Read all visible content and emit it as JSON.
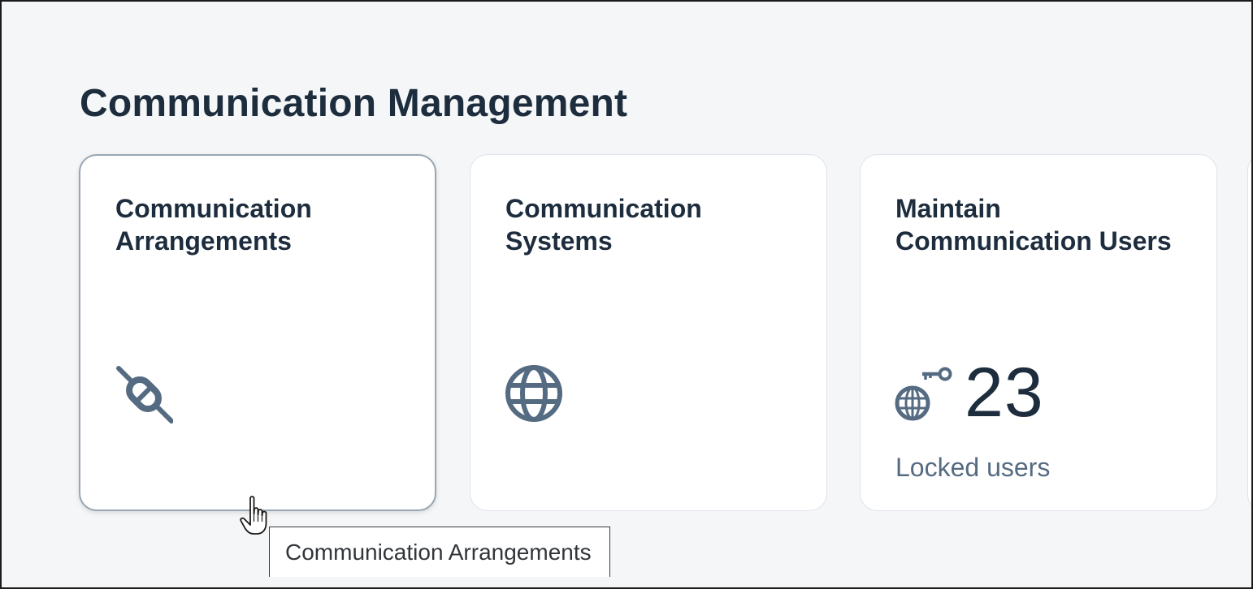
{
  "section": {
    "title": "Communication Management"
  },
  "tiles": [
    {
      "title": "Communication Arrangements",
      "icon": "plug-icon"
    },
    {
      "title": "Communication Systems",
      "icon": "globe-icon"
    },
    {
      "title": "Maintain Communication Users",
      "icon": "globe-key-icon",
      "kpi_value": "23",
      "kpi_label": "Locked users"
    }
  ],
  "tooltip": {
    "text": "Communication Arrangements"
  },
  "colors": {
    "background": "#f5f6f7",
    "tile": "#ffffff",
    "title_text": "#1d2d3e",
    "icon": "#556b82",
    "kpi_label": "#556b82",
    "hover_border": "#9aa6b4"
  }
}
